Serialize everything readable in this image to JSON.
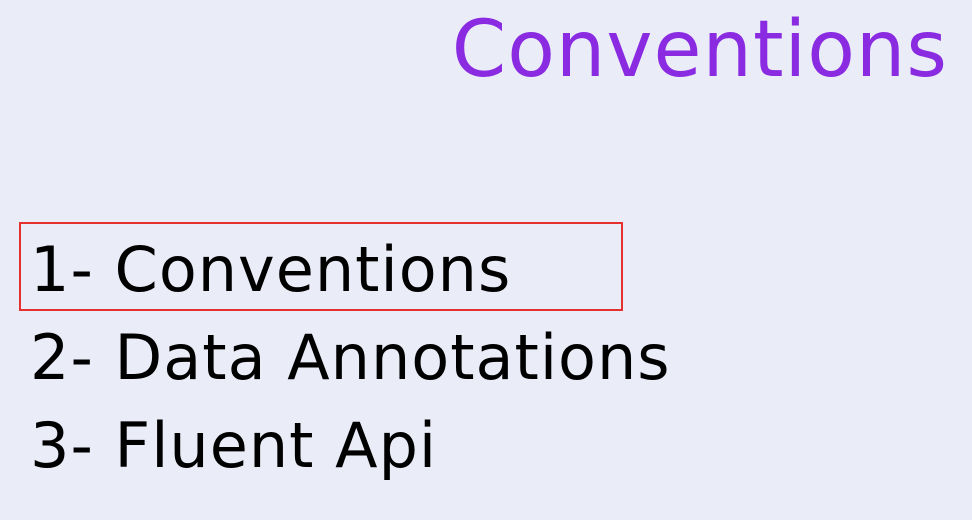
{
  "slide": {
    "title": "Conventions",
    "items": [
      {
        "label": "1- Conventions",
        "highlighted": true
      },
      {
        "label": "2- Data Annotations",
        "highlighted": false
      },
      {
        "label": "3- Fluent Api",
        "highlighted": false
      }
    ]
  },
  "colors": {
    "background": "#eaedf8",
    "title": "#8a2be2",
    "text": "#000000",
    "highlight_border": "#e53030"
  }
}
